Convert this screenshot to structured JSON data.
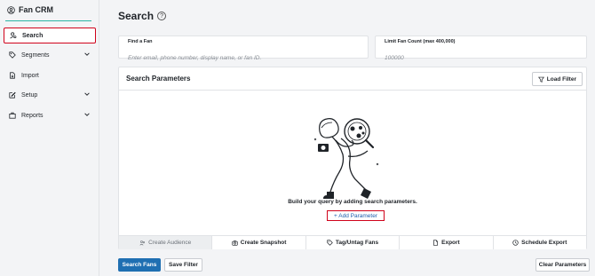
{
  "app": {
    "name": "Fan CRM"
  },
  "sidebar": {
    "items": [
      {
        "label": "Search",
        "icon": "person-search-icon",
        "active": true
      },
      {
        "label": "Segments",
        "icon": "tag-icon",
        "expandable": true
      },
      {
        "label": "Import",
        "icon": "file-import-icon"
      },
      {
        "label": "Setup",
        "icon": "edit-icon",
        "expandable": true
      },
      {
        "label": "Reports",
        "icon": "briefcase-icon",
        "expandable": true
      }
    ]
  },
  "page": {
    "title": "Search"
  },
  "find_fan": {
    "label": "Find a Fan",
    "placeholder": "Enter email, phone number, display name, or fan ID."
  },
  "limit": {
    "label": "Limit Fan Count (max 400,000)",
    "placeholder": "100000"
  },
  "params": {
    "title": "Search Parameters",
    "load_filter": "Load Filter",
    "empty_text": "Build your query by adding search parameters.",
    "add_parameter": "+ Add Parameter"
  },
  "actions": [
    {
      "label": "Create Audience",
      "icon": "audience-icon",
      "disabled": true
    },
    {
      "label": "Create Snapshot",
      "icon": "camera-icon"
    },
    {
      "label": "Tag/Untag Fans",
      "icon": "tag-icon"
    },
    {
      "label": "Export",
      "icon": "file-export-icon"
    },
    {
      "label": "Schedule Export",
      "icon": "clock-icon"
    }
  ],
  "footer": {
    "search_fans": "Search Fans",
    "save_filter": "Save Filter",
    "clear_parameters": "Clear Parameters"
  },
  "colors": {
    "primary": "#1f6fb2",
    "highlight": "#d0021b",
    "brand_line": "#2bb3a4"
  }
}
